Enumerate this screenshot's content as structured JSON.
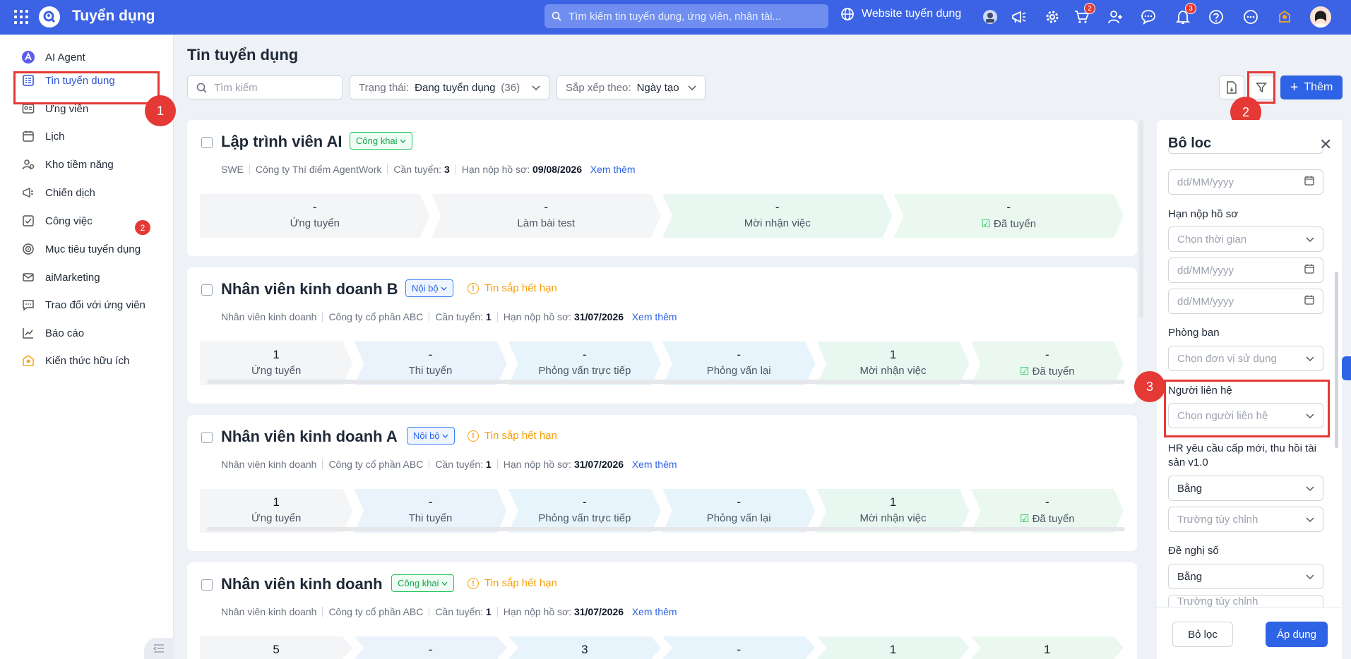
{
  "header": {
    "app_title": "Tuyển dụng",
    "search_placeholder": "Tìm kiếm tin tuyển dụng, ứng viên, nhân tài...",
    "website_label": "Website tuyển dụng",
    "cart_badge": "2",
    "bell_badge": "3"
  },
  "sidebar": {
    "items": [
      {
        "label": "AI Agent",
        "icon": "ai-agent-icon"
      },
      {
        "label": "Tin tuyển dụng",
        "icon": "job-post-icon",
        "active": true
      },
      {
        "label": "Ứng viên",
        "icon": "candidate-icon"
      },
      {
        "label": "Lịch",
        "icon": "calendar-icon"
      },
      {
        "label": "Kho tiềm năng",
        "icon": "talent-pool-icon"
      },
      {
        "label": "Chiến dịch",
        "icon": "megaphone-icon"
      },
      {
        "label": "Công việc",
        "icon": "task-icon",
        "badge": "2"
      },
      {
        "label": "Mục tiêu tuyển dụng",
        "icon": "target-icon"
      },
      {
        "label": "aiMarketing",
        "icon": "mail-icon"
      },
      {
        "label": "Trao đổi với ứng viên",
        "icon": "chat-icon"
      },
      {
        "label": "Báo cáo",
        "icon": "chart-icon"
      },
      {
        "label": "Kiến thức hữu ích",
        "icon": "knowledge-icon"
      }
    ]
  },
  "annotations": {
    "one": "1",
    "two": "2",
    "three": "3"
  },
  "toolbar": {
    "page_title": "Tin tuyển dụng",
    "search_placeholder": "Tìm kiếm",
    "status_label": "Trạng thái:",
    "status_value": "Đang tuyển dụng",
    "status_count": "(36)",
    "sort_label": "Sắp xếp theo:",
    "sort_value": "Ngày tạo",
    "add_label": "Thêm"
  },
  "jobs": [
    {
      "title": "Lập trình viên AI",
      "tag": "Công khai",
      "warning": "",
      "dept": "SWE",
      "company": "Công ty Thí điểm AgentWork",
      "need_label": "Cần tuyển:",
      "need": "3",
      "deadline_label": "Hạn nộp hồ sơ:",
      "deadline": "09/08/2026",
      "more": "Xem thêm",
      "stages": [
        {
          "value": "-",
          "name": "Ứng tuyển"
        },
        {
          "value": "-",
          "name": "Làm bài test"
        },
        {
          "value": "-",
          "name": "Mời nhận việc"
        },
        {
          "value": "-",
          "name": "Đã tuyển"
        }
      ]
    },
    {
      "title": "Nhân viên kinh doanh B",
      "tag": "Nội bộ",
      "warning": "Tin sắp hết hạn",
      "dept": "Nhân viên kinh doanh",
      "company": "Công ty cổ phần ABC",
      "need_label": "Cần tuyển:",
      "need": "1",
      "deadline_label": "Hạn nộp hồ sơ:",
      "deadline": "31/07/2026",
      "more": "Xem thêm",
      "stages": [
        {
          "value": "1",
          "name": "Ứng tuyển"
        },
        {
          "value": "-",
          "name": "Thi tuyển"
        },
        {
          "value": "-",
          "name": "Phỏng vấn trực tiếp"
        },
        {
          "value": "-",
          "name": "Phỏng vấn lại"
        },
        {
          "value": "1",
          "name": "Mời nhận việc"
        },
        {
          "value": "-",
          "name": "Đã tuyển"
        }
      ]
    },
    {
      "title": "Nhân viên kinh doanh A",
      "tag": "Nội bộ",
      "warning": "Tin sắp hết hạn",
      "dept": "Nhân viên kinh doanh",
      "company": "Công ty cổ phần ABC",
      "need_label": "Cần tuyển:",
      "need": "1",
      "deadline_label": "Hạn nộp hồ sơ:",
      "deadline": "31/07/2026",
      "more": "Xem thêm",
      "stages": [
        {
          "value": "1",
          "name": "Ứng tuyển"
        },
        {
          "value": "-",
          "name": "Thi tuyển"
        },
        {
          "value": "-",
          "name": "Phỏng vấn trực tiếp"
        },
        {
          "value": "-",
          "name": "Phỏng vấn lại"
        },
        {
          "value": "1",
          "name": "Mời nhận việc"
        },
        {
          "value": "-",
          "name": "Đã tuyển"
        }
      ]
    },
    {
      "title": "Nhân viên kinh doanh",
      "tag": "Công khai",
      "warning": "Tin sắp hết hạn",
      "dept": "Nhân viên kinh doanh",
      "company": "Công ty cổ phần ABC",
      "need_label": "Cần tuyển:",
      "need": "1",
      "deadline_label": "Hạn nộp hồ sơ:",
      "deadline": "31/07/2026",
      "more": "Xem thêm",
      "stages": [
        {
          "value": "5",
          "name": ""
        },
        {
          "value": "-",
          "name": ""
        },
        {
          "value": "3",
          "name": ""
        },
        {
          "value": "-",
          "name": ""
        },
        {
          "value": "1",
          "name": ""
        },
        {
          "value": "1",
          "name": ""
        }
      ]
    }
  ],
  "filter": {
    "title": "Bộ lọc",
    "date_placeholder": "dd/MM/yyyy",
    "deadline_label": "Hạn nộp hồ sơ",
    "time_placeholder": "Chọn thời gian",
    "dept_label": "Phòng ban",
    "dept_placeholder": "Chọn đơn vị sử dụng",
    "contact_label": "Người liên hệ",
    "contact_placeholder": "Chọn người liên hệ",
    "hr_label": "HR yêu cầu cấp mới, thu hồi tài sản v1.0",
    "equal_value": "Bằng",
    "custom_placeholder": "Trường tùy chỉnh",
    "proposal_label": "Đề nghị số",
    "reset_label": "Bỏ lọc",
    "apply_label": "Áp dụng"
  }
}
